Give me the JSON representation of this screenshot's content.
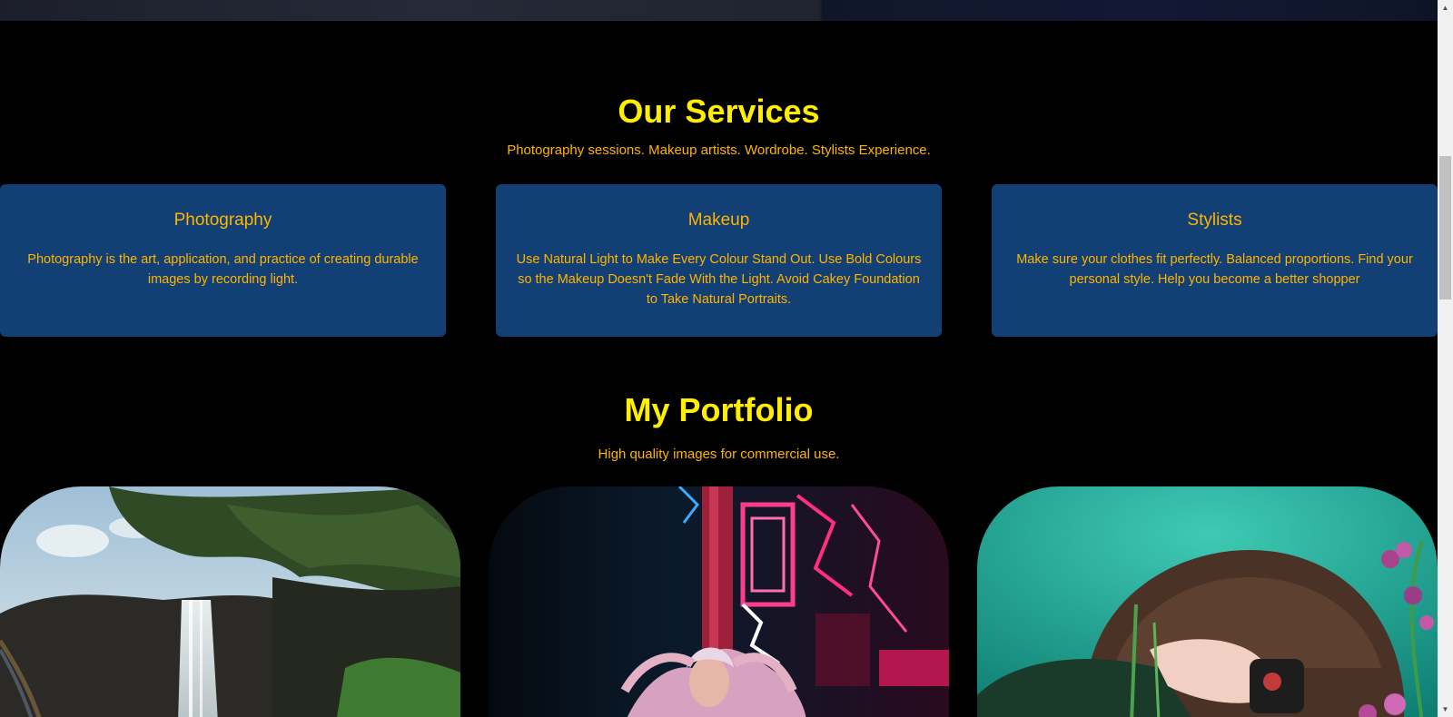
{
  "services": {
    "title": "Our Services",
    "subtitle": "Photography sessions. Makeup artists. Wordrobe. Stylists Experience.",
    "cards": [
      {
        "title": "Photography",
        "text": "Photography is the art, application, and practice of creating durable images by recording light."
      },
      {
        "title": "Makeup",
        "text": "Use Natural Light to Make Every Colour Stand Out. Use Bold Colours so the Makeup Doesn't Fade With the Light. Avoid Cakey Foundation to Take Natural Portraits."
      },
      {
        "title": "Stylists",
        "text": "Make sure your clothes fit perfectly. Balanced proportions. Find your personal style. Help you become a better shopper"
      }
    ]
  },
  "portfolio": {
    "title": "My Portfolio",
    "subtitle": "High quality images for commercial use.",
    "images": [
      "waterfall-photo",
      "neon-portrait-photo",
      "flower-photographer-photo"
    ]
  },
  "colors": {
    "background": "#000000",
    "heading": "#ffee00",
    "accent_text": "#ffb400",
    "card_bg": "#123f74"
  },
  "scrollbar": {
    "up_icon": "scroll-up-arrow-icon",
    "down_icon": "scroll-down-arrow-icon"
  }
}
